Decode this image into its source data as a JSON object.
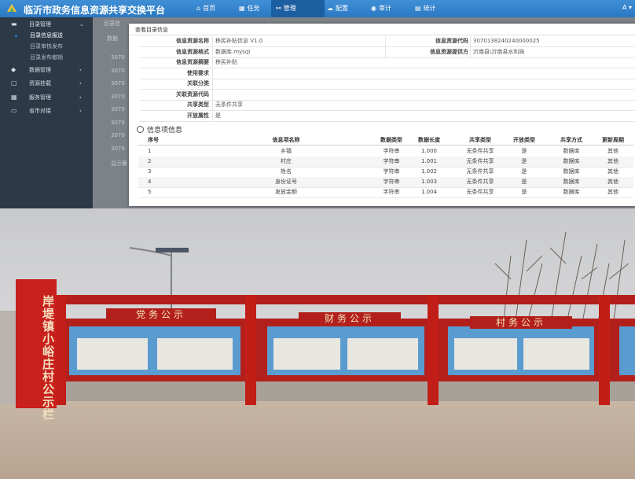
{
  "app": {
    "title": "临沂市政务信息资源共享交换平台",
    "nav": [
      {
        "label": "首页",
        "icon": "home-icon"
      },
      {
        "label": "任务",
        "icon": "calendar-icon"
      },
      {
        "label": "管理",
        "icon": "share-icon"
      },
      {
        "label": "配置",
        "icon": "cloud-icon"
      },
      {
        "label": "审计",
        "icon": "eye-icon"
      },
      {
        "label": "统计",
        "icon": "chart-icon"
      }
    ],
    "active_nav": "管理"
  },
  "sidebar": {
    "groups": [
      {
        "label": "目录管理",
        "icon": "folder-icon",
        "expanded": true,
        "children": [
          "目录信息报送",
          "目录审核发布",
          "目录发布撤销"
        ]
      },
      {
        "label": "数据管理",
        "icon": "database-icon"
      },
      {
        "label": "资源挂载",
        "icon": "file-icon"
      },
      {
        "label": "服务管理",
        "icon": "grid-icon"
      },
      {
        "label": "省市对接",
        "icon": "link-icon"
      }
    ],
    "active_child": "目录信息报送"
  },
  "background": {
    "tab": "目录信",
    "col": "数据",
    "rows": [
      "3070",
      "3070",
      "3070",
      "3070",
      "3070",
      "3070",
      "3070",
      "3070"
    ],
    "footer": "显示第"
  },
  "modal": {
    "title": "查看目录信息",
    "meta": [
      {
        "label": "信息资源名称",
        "value": "移民补贴信息 V1.0",
        "label2": "信息资源代码",
        "value2": "3070138240240000025"
      },
      {
        "label": "信息资源格式",
        "value": "数据库.mysql",
        "label2": "信息资源提供方",
        "value2": "沂南县\\沂南县水利局"
      },
      {
        "label": "信息资源摘要",
        "value": "移民补贴"
      },
      {
        "label": "使用要求",
        "value": ""
      },
      {
        "label": "关联分类",
        "value": ""
      },
      {
        "label": "关联资源代码",
        "value": ""
      },
      {
        "label": "共享类型",
        "value": "无条件共享"
      },
      {
        "label": "开放属性",
        "value": "是"
      }
    ],
    "info_section_title": "信息项信息",
    "table": {
      "headers": [
        "序号",
        "信息项名称",
        "数据类型",
        "数据长度",
        "共享类型",
        "开放类型",
        "共享方式",
        "更新周期"
      ],
      "rows": [
        [
          "1",
          "乡镇",
          "字符串",
          "1.000",
          "无条件共享",
          "是",
          "数据库",
          "其他"
        ],
        [
          "2",
          "村庄",
          "字符串",
          "1.001",
          "无条件共享",
          "是",
          "数据库",
          "其他"
        ],
        [
          "3",
          "姓名",
          "字符串",
          "1.002",
          "无条件共享",
          "是",
          "数据库",
          "其他"
        ],
        [
          "4",
          "身份证号",
          "字符串",
          "1.003",
          "无条件共享",
          "是",
          "数据库",
          "其他"
        ],
        [
          "5",
          "发放金额",
          "字符串",
          "1.004",
          "无条件共享",
          "是",
          "数据库",
          "其他"
        ]
      ]
    }
  },
  "photo": {
    "vertical_sign": "岸堤镇小峪庄村公示栏",
    "boards": [
      "党务公示",
      "财务公示",
      "村务公示"
    ],
    "colors": {
      "sign_red": "#c8201c",
      "board_blue": "#5a9bd0",
      "sky": "#cfd1d4",
      "ground": "#c9b8a8"
    }
  }
}
